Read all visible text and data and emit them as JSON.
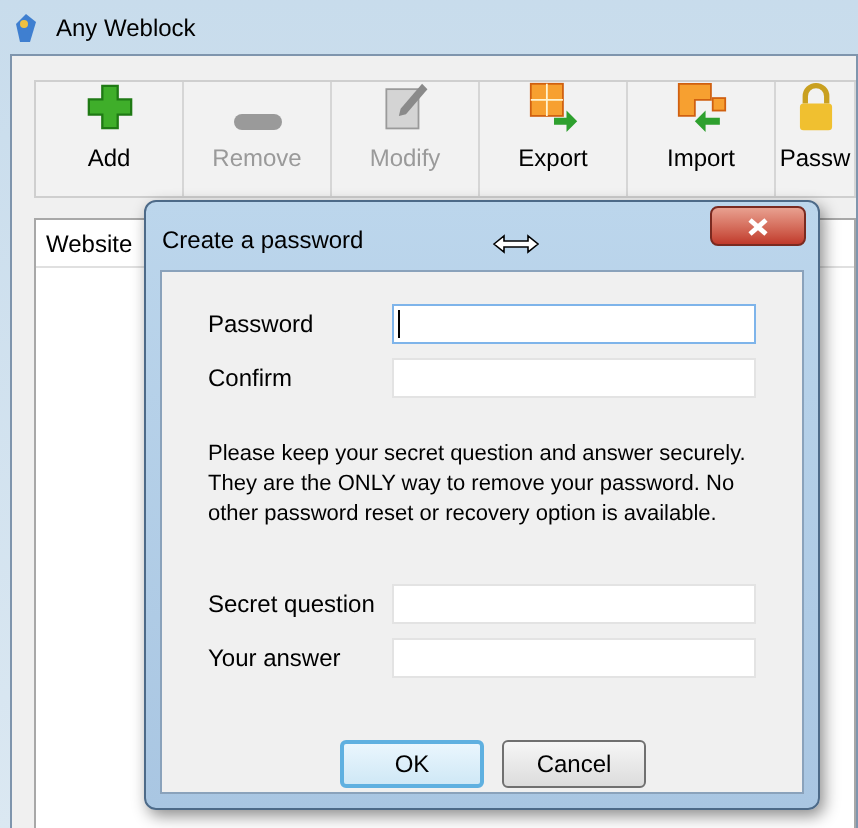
{
  "window": {
    "title": "Any Weblock"
  },
  "toolbar": [
    {
      "kind": "add",
      "label": "Add",
      "disabled": false
    },
    {
      "kind": "remove",
      "label": "Remove",
      "disabled": true
    },
    {
      "kind": "modify",
      "label": "Modify",
      "disabled": true
    },
    {
      "kind": "export",
      "label": "Export",
      "disabled": false
    },
    {
      "kind": "import",
      "label": "Import",
      "disabled": false
    },
    {
      "kind": "password",
      "label": "Passw",
      "disabled": false
    }
  ],
  "table": {
    "columns": [
      "Website"
    ]
  },
  "dialog": {
    "title": "Create a password",
    "fields": [
      {
        "label": "Password",
        "focused": true
      },
      {
        "label": "Confirm",
        "focused": false
      }
    ],
    "notice": "Please keep your secret question and answer securely. They are the ONLY way to remove your password. No other password reset or recovery option is available.",
    "secret_fields": [
      {
        "label": "Secret question",
        "focused": false
      },
      {
        "label": "Your answer",
        "focused": false
      }
    ],
    "buttons": [
      {
        "label": "OK",
        "default": true
      },
      {
        "label": "Cancel",
        "default": false
      }
    ]
  }
}
